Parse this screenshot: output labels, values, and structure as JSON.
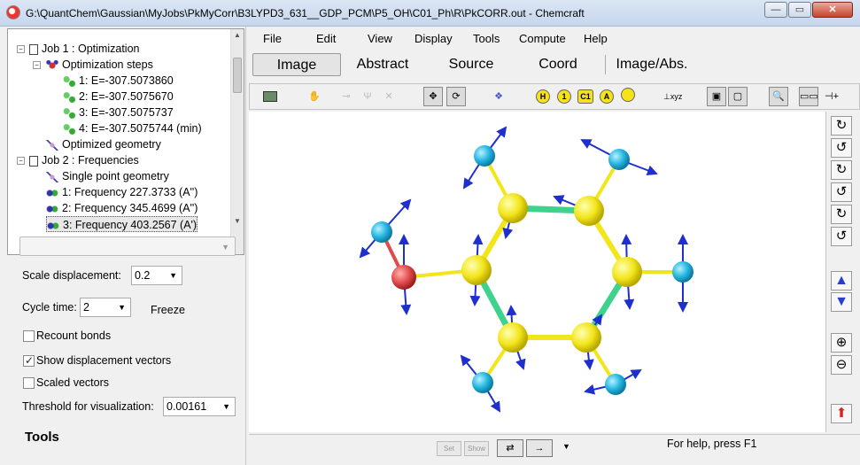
{
  "window": {
    "title": "G:\\QuantChem\\Gaussian\\MyJobs\\PkMyCorr\\B3LYPD3_631__GDP_PCM\\P5_OH\\C01_Ph\\R\\PkCORR.out - Chemcraft",
    "minimize": "—",
    "maximize": "▭",
    "close": "✕"
  },
  "tree": {
    "items": [
      {
        "label": "Job 1 : Optimization",
        "icon": "document-icon"
      },
      {
        "label": "Optimization steps",
        "icon": "molecule-icon"
      },
      {
        "label": "1: E=-307.5073860",
        "icon": "step-icon"
      },
      {
        "label": "2: E=-307.5075670",
        "icon": "step-icon"
      },
      {
        "label": "3: E=-307.5075737",
        "icon": "step-icon"
      },
      {
        "label": "4: E=-307.5075744 (min)",
        "icon": "step-icon"
      },
      {
        "label": "Optimized geometry",
        "icon": "geometry-icon"
      },
      {
        "label": "Job 2 : Frequencies",
        "icon": "document-icon"
      },
      {
        "label": "Single point geometry",
        "icon": "geometry-icon"
      },
      {
        "label": "1: Frequency 227.3733 (A'')",
        "icon": "frequency-icon"
      },
      {
        "label": "2: Frequency 345.4699 (A'')",
        "icon": "frequency-icon"
      },
      {
        "label": "3: Frequency 403.2567 (A')",
        "icon": "frequency-icon"
      }
    ]
  },
  "controls": {
    "scale_label": "Scale displacement:",
    "scale_value": "0.2",
    "cycle_label": "Cycle time:",
    "cycle_value": "2",
    "freeze_label": "Freeze",
    "recount_label": "Recount bonds",
    "recount_checked": false,
    "show_vectors_label": "Show displacement vectors",
    "show_vectors_checked": true,
    "scaled_label": "Scaled vectors",
    "scaled_checked": false,
    "threshold_label": "Threshold for visualization:",
    "threshold_value": "0.00161",
    "tools_title": "Tools"
  },
  "menu": [
    "File",
    "Edit",
    "View",
    "Display",
    "Tools",
    "Compute",
    "Help"
  ],
  "tabs": {
    "image": "Image",
    "abstract": "Abstract",
    "source": "Source",
    "coord": "Coord",
    "image_abs": "Image/Abs.",
    "active": "Image"
  },
  "toolbar": {
    "atom_h": "H",
    "atom_1": "1",
    "atom_c1": "C1",
    "atom_a": "A"
  },
  "rightbar": {
    "up_arrow": "▲",
    "down_arrow": "▼"
  },
  "status": {
    "set_label": "Set",
    "show_label": "Show",
    "help_text": "For help, press F1"
  },
  "colors": {
    "carbon": "#f2e51a",
    "hydrogen": "#21b5e0",
    "oxygen": "#e14a4a",
    "bond_green": "#3fd28c",
    "vector": "#1f2fcf"
  }
}
